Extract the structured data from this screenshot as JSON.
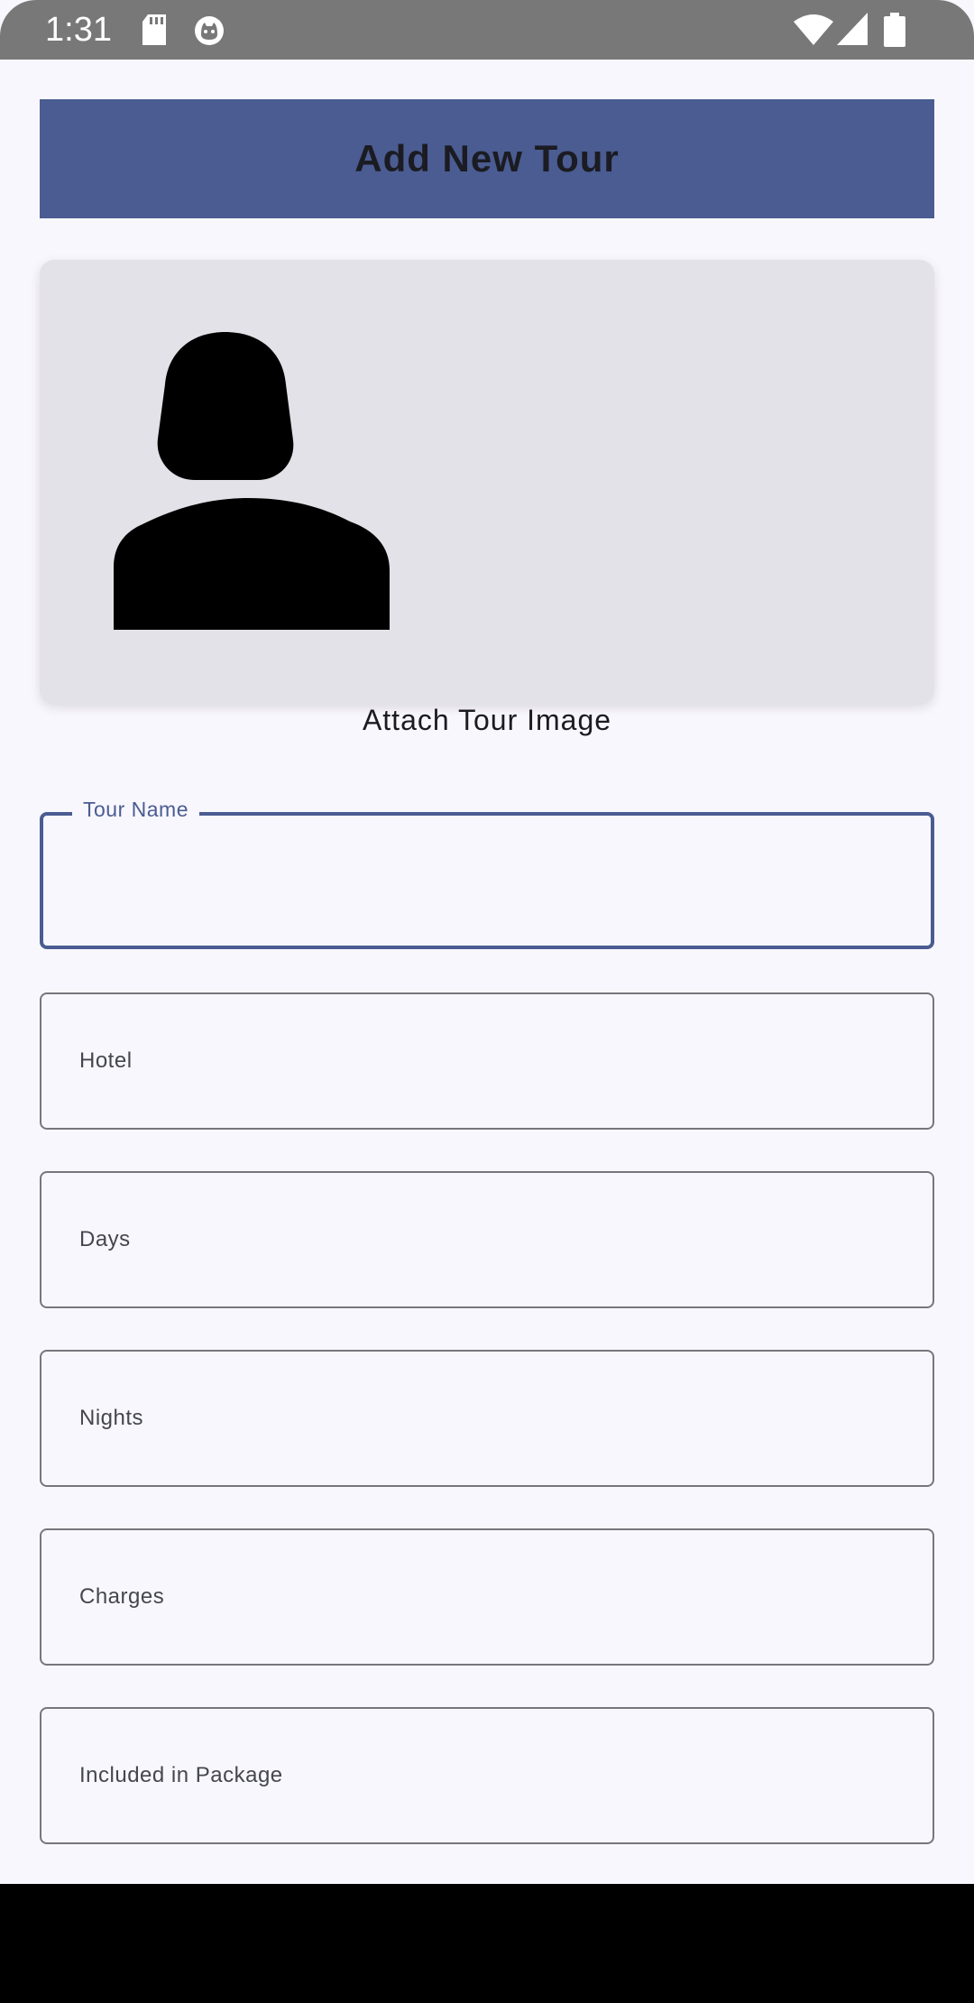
{
  "status_bar": {
    "time": "1:31",
    "icons": [
      "sd-card-icon",
      "cat-face-icon",
      "wifi-icon",
      "signal-icon",
      "battery-icon"
    ]
  },
  "header": {
    "title": "Add New Tour",
    "color": "#4a5c91"
  },
  "image_picker": {
    "label": "Attach Tour Image",
    "icon": "person-placeholder-icon"
  },
  "form": {
    "tour_name": {
      "label": "Tour Name",
      "value": ""
    },
    "hotel": {
      "label": "Hotel"
    },
    "days": {
      "label": "Days"
    },
    "nights": {
      "label": "Nights"
    },
    "charges": {
      "label": "Charges"
    },
    "included": {
      "label": "Included in Package"
    }
  }
}
